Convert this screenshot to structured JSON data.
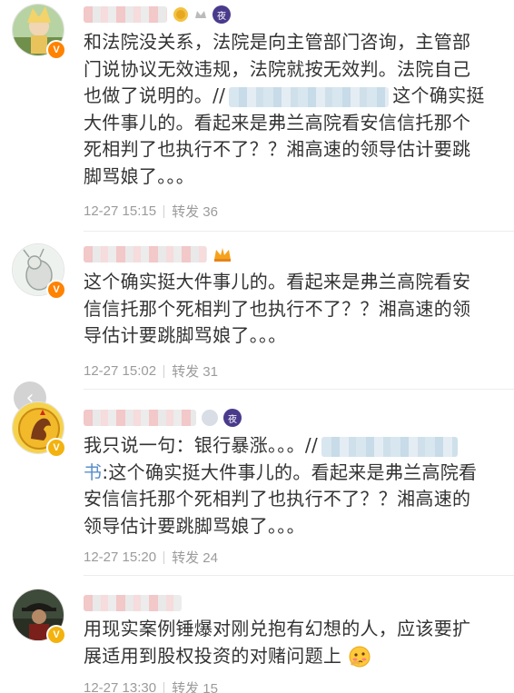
{
  "comments": [
    {
      "badges": [
        "coin-icon",
        "night-badge"
      ],
      "night": "夜",
      "verified": "V",
      "lines": [
        "和法院没关系，法院是向主管部门咨询，主管部",
        "门说协议无效违规，法院就按无效判。法院自己",
        "也做了说明的。//",
        "这个确实挺",
        "大件事儿的。看起来是弗兰高院看安信信托那个",
        "死相判了也执行不了？？湘高速的领导估计要跳",
        "脚骂娘了。。。"
      ],
      "time": "12-27 15:15",
      "repost": "转发 36"
    },
    {
      "verified": "V",
      "lines": [
        "这个确实挺大件事儿的。看起来是弗兰高院看安",
        "信信托那个死相判了也执行不了？？湘高速的领",
        "导估计要跳脚骂娘了。。。"
      ],
      "time": "12-27 15:02",
      "repost": "转发 31"
    },
    {
      "verified": "V",
      "night": "夜",
      "lines": [
        "我只说一句：银行暴涨。。。//",
        "书",
        ":这个确实挺大件事儿的。看起来是弗兰高院看",
        "安信信托那个死相判了也执行不了？？湘高速的",
        "领导估计要跳脚骂娘了。。。"
      ],
      "time": "12-27 15:20",
      "repost": "转发 24"
    },
    {
      "verified": "V",
      "lines": [
        "用现实案例锤爆对刚兑抱有幻想的人，应该要扩",
        "展适用到股权投资的对赌问题上"
      ],
      "time": "12-27 13:30",
      "repost": "转发 15"
    }
  ],
  "back_button": "‹",
  "colors": {
    "verified": "#ff8200",
    "verified_gold": "#f3b20e",
    "link": "#5a8fc9",
    "meta": "#9b9b9b"
  }
}
